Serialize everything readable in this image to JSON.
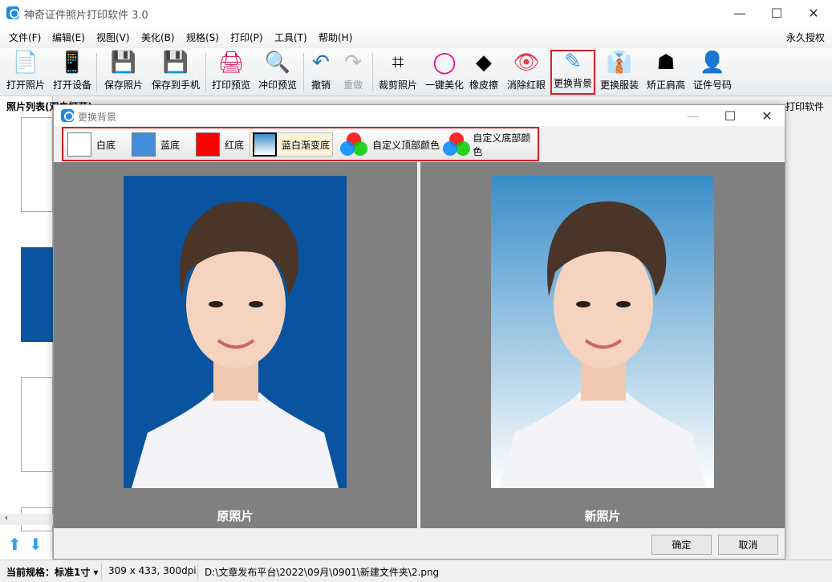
{
  "window": {
    "title": "神奇证件照片打印软件 3.0",
    "controls": [
      "—",
      "☐",
      "✕"
    ]
  },
  "menu": [
    "文件(F)",
    "编辑(E)",
    "视图(V)",
    "美化(B)",
    "规格(S)",
    "打印(P)",
    "工具(T)",
    "帮助(H)"
  ],
  "license": "永久授权",
  "toolbar": [
    {
      "label": "打开照片",
      "icon": "open-photo-icon",
      "glyph": "📄"
    },
    {
      "label": "打开设备",
      "icon": "phone-icon",
      "glyph": "📱"
    },
    {
      "label": "保存照片",
      "icon": "save-icon",
      "glyph": "💾"
    },
    {
      "label": "保存到手机",
      "icon": "save-to-phone-icon",
      "glyph": "💾"
    },
    {
      "label": "打印预览",
      "icon": "printer-icon",
      "glyph": "🖨"
    },
    {
      "label": "冲印预览",
      "icon": "print-search-icon",
      "glyph": "🔍"
    },
    {
      "label": "撤销",
      "icon": "undo-icon",
      "glyph": "↶"
    },
    {
      "label": "重做",
      "icon": "redo-icon",
      "glyph": "↷"
    },
    {
      "label": "裁剪照片",
      "icon": "crop-icon",
      "glyph": "⌗"
    },
    {
      "label": "一键美化",
      "icon": "color-wheel-icon",
      "glyph": "◯"
    },
    {
      "label": "橡皮擦",
      "icon": "eraser-icon",
      "glyph": "◆"
    },
    {
      "label": "消除红眼",
      "icon": "eye-icon",
      "glyph": "👁"
    },
    {
      "label": "更换背景",
      "icon": "brush-icon",
      "glyph": "✎"
    },
    {
      "label": "更换服装",
      "icon": "suit-icon",
      "glyph": "👔"
    },
    {
      "label": "矫正肩高",
      "icon": "shoulder-icon",
      "glyph": "☗"
    },
    {
      "label": "证件号码",
      "icon": "id-photo-icon",
      "glyph": "👤"
    }
  ],
  "panel": {
    "title": "照片列表(双击打开)",
    "right_text": "打印软件"
  },
  "dialog": {
    "title": "更换背景",
    "options": [
      {
        "label": "白底",
        "color": "#ffffff"
      },
      {
        "label": "蓝底",
        "color": "#438edb"
      },
      {
        "label": "红底",
        "color": "#ff0000"
      },
      {
        "label": "蓝白渐变底",
        "color": "linear-gradient(#3a8dc8,#ffffff)",
        "selected": true
      },
      {
        "label": "自定义顶部颜色",
        "icon": "rgb-icon"
      },
      {
        "label": "自定义底部颜色",
        "icon": "rgb-icon"
      }
    ],
    "original_label": "原照片",
    "new_label": "新照片",
    "original_bg": "#0a549f",
    "ok": "确定",
    "cancel": "取消"
  },
  "status": {
    "spec_label": "当前规格：",
    "spec_value": "标准1寸",
    "size": "309 x 433, 300dpi",
    "path": "D:\\文章发布平台\\2022\\09月\\0901\\新建文件夹\\2.png"
  }
}
